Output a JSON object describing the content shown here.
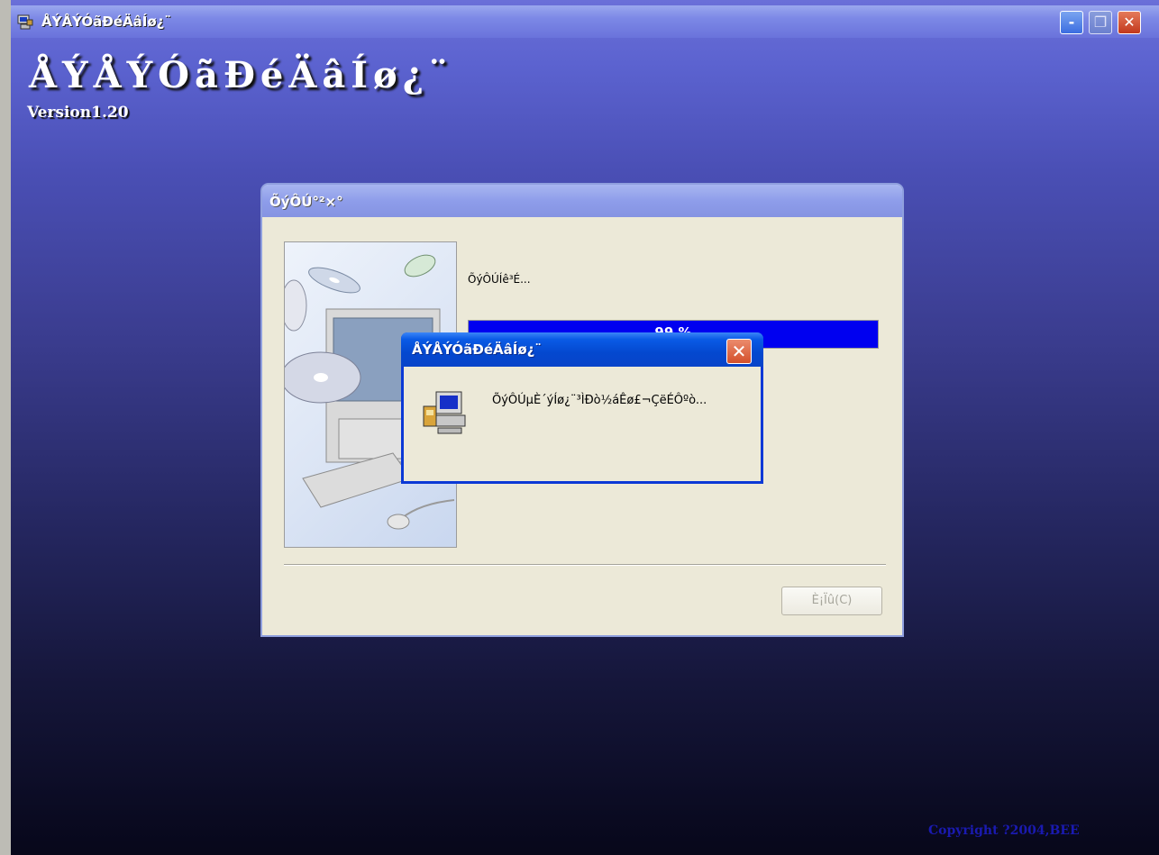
{
  "window": {
    "title": "ÅÝÅÝÓãÐéÄâÍø¿¨",
    "heading": "ÅÝÅÝÓãÐéÄâÍø¿¨",
    "version": "Version1.20",
    "copyright": "Copyright ?2004,BEE",
    "buttons": {
      "minimize": "-",
      "maximize": "❐",
      "close": "✕"
    }
  },
  "install_dialog": {
    "title": "ÕýÔÚ°²×°",
    "status": "ÕýÔÚÍê³É...",
    "progress": {
      "percent": 100,
      "label": "99 %"
    },
    "cancel_label": "È¡Ïû(C)"
  },
  "message_box": {
    "title": "ÅÝÅÝÓãÐéÄâÍø¿¨",
    "text": "ÕýÔÚµÈ´ýÍø¿¨³ÌÐò½áÊø£¬ÇëÉÔºò...",
    "close_glyph": "✕"
  },
  "colors": {
    "progress_fill": "#0000f0",
    "message_titlebar": "#0448cf",
    "dialog_bg": "#ece9d8"
  }
}
